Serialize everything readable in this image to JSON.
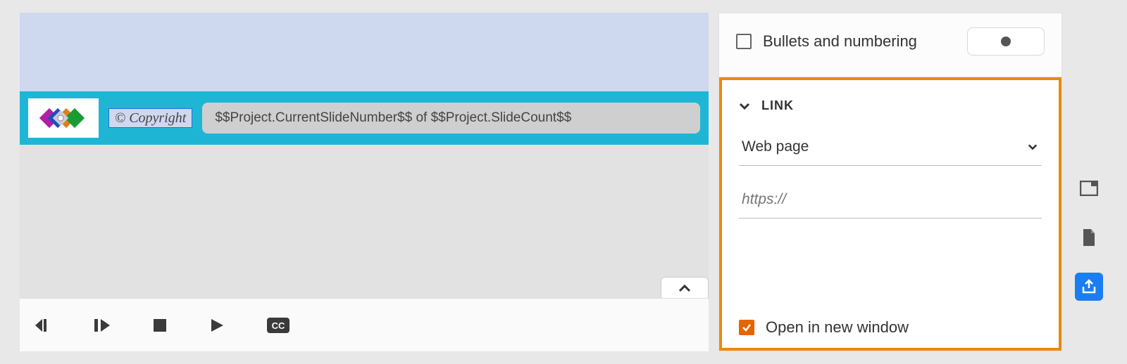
{
  "slide": {
    "copyright": "© Copyright",
    "slideNumberVar": "$$Project.CurrentSlideNumber$$  of $$Project.SlideCount$$"
  },
  "props": {
    "bullets": {
      "label": "Bullets and numbering",
      "checked": false
    },
    "link": {
      "sectionTitle": "LINK",
      "typeLabel": "Web page",
      "urlPlaceholder": "https://",
      "urlValue": "",
      "openNewLabel": "Open in new window",
      "openNewChecked": true
    }
  }
}
